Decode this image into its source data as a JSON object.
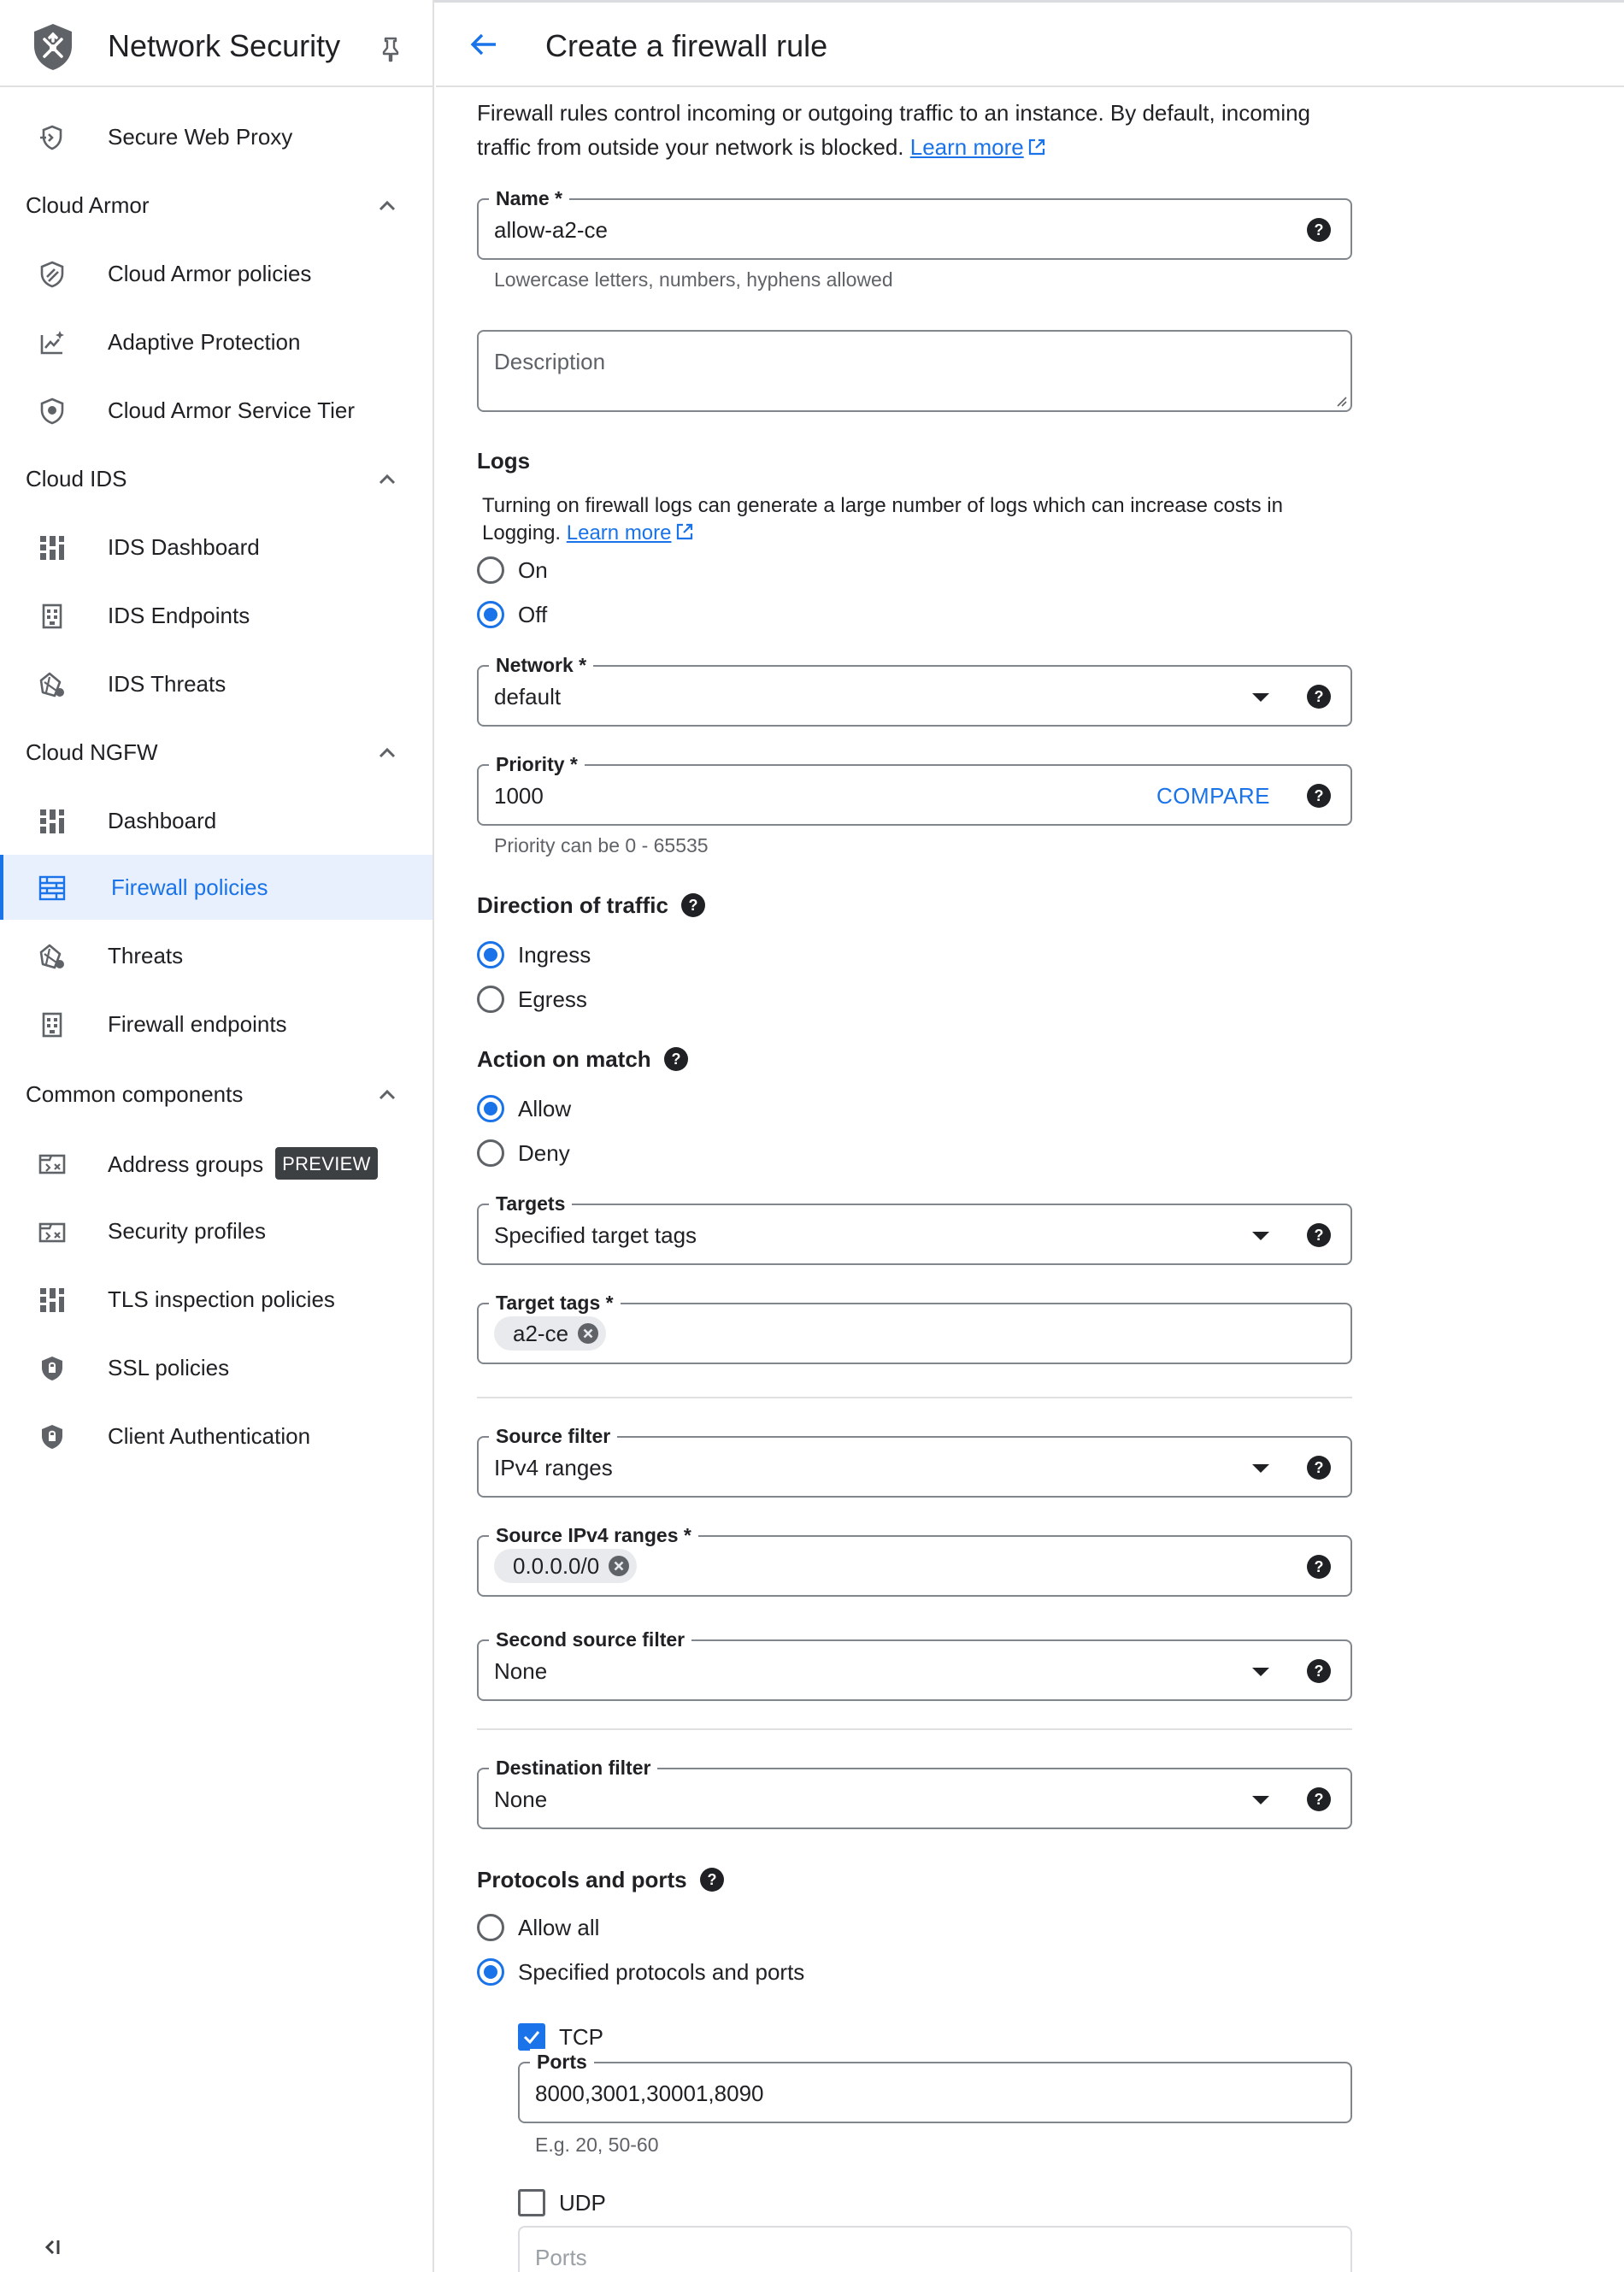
{
  "app": {
    "title": "Network Security"
  },
  "sidebar": {
    "top_item": {
      "label": "Secure Web Proxy",
      "icon": "secure-web-proxy-icon"
    },
    "sections": [
      {
        "label": "Cloud Armor",
        "items": [
          {
            "label": "Cloud Armor policies",
            "icon": "shield-striped-icon"
          },
          {
            "label": "Adaptive Protection",
            "icon": "chart-sparkle-icon"
          },
          {
            "label": "Cloud Armor Service Tier",
            "icon": "shield-badge-icon"
          }
        ]
      },
      {
        "label": "Cloud IDS",
        "items": [
          {
            "label": "IDS Dashboard",
            "icon": "dashboard-icon"
          },
          {
            "label": "IDS Endpoints",
            "icon": "endpoint-icon"
          },
          {
            "label": "IDS Threats",
            "icon": "threat-icon"
          }
        ]
      },
      {
        "label": "Cloud NGFW",
        "items": [
          {
            "label": "Dashboard",
            "icon": "dashboard-icon"
          },
          {
            "label": "Firewall policies",
            "icon": "firewall-icon",
            "active": true
          },
          {
            "label": "Threats",
            "icon": "threat-icon"
          },
          {
            "label": "Firewall endpoints",
            "icon": "endpoint-icon"
          }
        ]
      },
      {
        "label": "Common components",
        "items": [
          {
            "label": "Address groups",
            "icon": "address-group-icon",
            "badge": "PREVIEW"
          },
          {
            "label": "Security profiles",
            "icon": "address-group-icon"
          },
          {
            "label": "TLS inspection policies",
            "icon": "dashboard-icon"
          },
          {
            "label": "SSL policies",
            "icon": "shield-lock-icon"
          },
          {
            "label": "Client Authentication",
            "icon": "shield-lock-icon"
          }
        ]
      }
    ]
  },
  "page": {
    "title": "Create a firewall rule",
    "intro": "Firewall rules control incoming or outgoing traffic to an instance. By default, incoming traffic from outside your network is blocked.",
    "intro_link": "Learn more"
  },
  "form": {
    "name": {
      "label": "Name *",
      "value": "allow-a2-ce",
      "hint": "Lowercase letters, numbers, hyphens allowed"
    },
    "description": {
      "placeholder": "Description"
    },
    "logs": {
      "title": "Logs",
      "text": "Turning on firewall logs can generate a large number of logs which can increase costs in Logging.",
      "link": "Learn more",
      "options": [
        "On",
        "Off"
      ],
      "selected": "Off"
    },
    "network": {
      "label": "Network *",
      "value": "default"
    },
    "priority": {
      "label": "Priority *",
      "value": "1000",
      "compare": "COMPARE",
      "hint": "Priority can be 0 - 65535"
    },
    "direction": {
      "title": "Direction of traffic",
      "options": [
        "Ingress",
        "Egress"
      ],
      "selected": "Ingress"
    },
    "action": {
      "title": "Action on match",
      "options": [
        "Allow",
        "Deny"
      ],
      "selected": "Allow"
    },
    "targets": {
      "label": "Targets",
      "value": "Specified target tags"
    },
    "target_tags": {
      "label": "Target tags *",
      "chips": [
        "a2-ce"
      ]
    },
    "source_filter": {
      "label": "Source filter",
      "value": "IPv4 ranges"
    },
    "source_ranges": {
      "label": "Source IPv4 ranges *",
      "chips": [
        "0.0.0.0/0"
      ]
    },
    "second_source": {
      "label": "Second source filter",
      "value": "None"
    },
    "destination": {
      "label": "Destination filter",
      "value": "None"
    },
    "protocols": {
      "title": "Protocols and ports",
      "options": [
        "Allow all",
        "Specified protocols and ports"
      ],
      "selected": "Specified protocols and ports",
      "tcp": {
        "label": "TCP",
        "checked": true,
        "ports_label": "Ports",
        "ports_value": "8000,3001,30001,8090",
        "hint": "E.g. 20, 50-60"
      },
      "udp": {
        "label": "UDP",
        "checked": false,
        "ports_placeholder": "Ports"
      }
    }
  },
  "colors": {
    "accent": "#1a73e8",
    "active_bg": "#e8f0fe",
    "text": "#202124",
    "muted": "#5f6368",
    "badge_bg": "#3c4043"
  }
}
